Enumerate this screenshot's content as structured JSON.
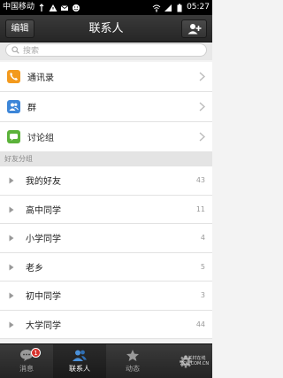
{
  "status_bar": {
    "carrier": "中国移动",
    "time": "05:27"
  },
  "header": {
    "edit_label": "编辑",
    "title": "联系人",
    "add_icon": "add-contact-icon"
  },
  "search": {
    "placeholder": "搜索"
  },
  "menu": [
    {
      "label": "通讯录",
      "icon": "phone-book-icon",
      "color": "#f39a1e"
    },
    {
      "label": "群",
      "icon": "group-icon",
      "color": "#3d86d8"
    },
    {
      "label": "讨论组",
      "icon": "chat-bubble-icon",
      "color": "#5bb23a"
    }
  ],
  "groups_header": "好友分组",
  "groups": [
    {
      "name": "我的好友",
      "count": "43"
    },
    {
      "name": "高中同学",
      "count": "11"
    },
    {
      "name": "小学同学",
      "count": "4"
    },
    {
      "name": "老乡",
      "count": "5"
    },
    {
      "name": "初中同学",
      "count": "3"
    },
    {
      "name": "大学同学",
      "count": "44"
    }
  ],
  "tabs": [
    {
      "label": "消息",
      "icon": "message-icon",
      "badge": "1"
    },
    {
      "label": "联系人",
      "icon": "contacts-icon"
    },
    {
      "label": "动态",
      "icon": "star-icon"
    },
    {
      "label": "设置",
      "icon": "gear-icon"
    }
  ],
  "watermark": {
    "line1": "中关村在线",
    "line2": "ZOL.COM.CN"
  }
}
